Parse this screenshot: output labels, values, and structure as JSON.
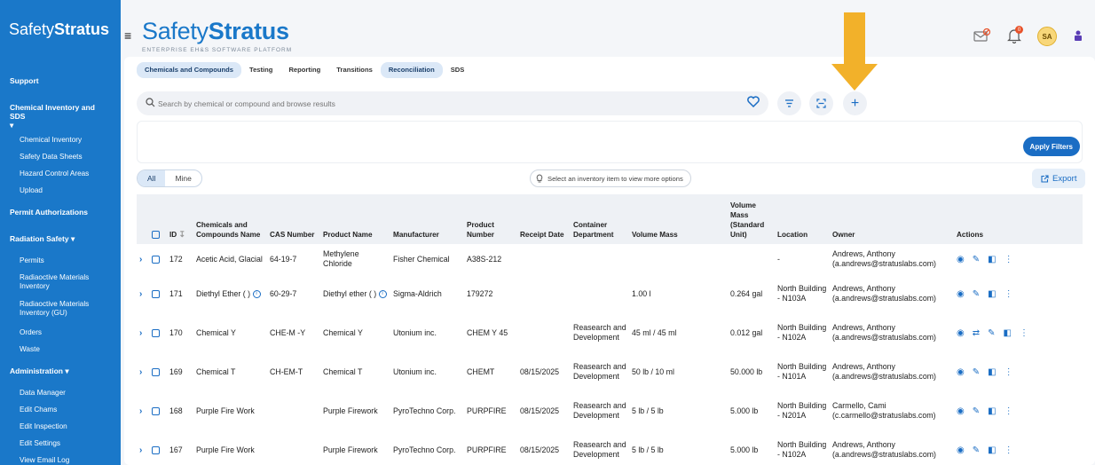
{
  "sidebar": {
    "logo_light": "Safety",
    "logo_bold": "Stratus",
    "sections": [
      {
        "label": "Support",
        "items": []
      },
      {
        "label": "Chemical Inventory and SDS",
        "caret": "▾",
        "items": [
          "Chemical Inventory",
          "Safety Data Sheets",
          "Hazard Control Areas",
          "Upload"
        ]
      },
      {
        "label": "Permit Authorizations",
        "items": []
      },
      {
        "label": "Radiation Safety ▾",
        "items": [
          "Permits",
          "Radiaoctive Materials Inventory",
          "Radiaoctive Materials Inventory (GU)",
          "Orders",
          "Waste"
        ]
      },
      {
        "label": "Administration ▾",
        "items": [
          "Data Manager",
          "Edit Chams",
          "Edit Inspection",
          "Edit Settings",
          "View Email Log"
        ]
      }
    ]
  },
  "header": {
    "brand_light": "Safety",
    "brand_bold": "Stratus",
    "brand_sub": "ENTERPRISE EH&S SOFTWARE PLATFORM",
    "notification_count": "0",
    "avatar": "SA"
  },
  "tabs": [
    "Chemicals and Compounds",
    "Testing",
    "Reporting",
    "Transitions",
    "Reconciliation",
    "SDS"
  ],
  "active_tabs": [
    0,
    4
  ],
  "search": {
    "placeholder": "Search by chemical or compound and browse results"
  },
  "apply_filters": "Apply Filters",
  "segment": {
    "all": "All",
    "mine": "Mine"
  },
  "hint": "Select an inventory item to view more options",
  "export": "Export",
  "table": {
    "headers": {
      "id": "ID",
      "name": "Chemicals and Compounds Name",
      "cas": "CAS Number",
      "product": "Product Name",
      "manufacturer": "Manufacturer",
      "product_number": "Product Number",
      "receipt": "Receipt Date",
      "dept": "Container Department",
      "volume": "Volume Mass",
      "volume_std": "Volume Mass (Standard Unit)",
      "location": "Location",
      "owner": "Owner",
      "actions": "Actions"
    },
    "rows": [
      {
        "id": "172",
        "name": "Acetic Acid, Glacial",
        "cas": "64-19-7",
        "product": "Methylene Chloride",
        "manufacturer": "Fisher Chemical",
        "product_number": "A38S-212",
        "receipt": "",
        "dept": "",
        "volume": "",
        "volume_std": "",
        "location": "-",
        "owner": "Andrews, Anthony (a.andrews@stratuslabs.com)"
      },
      {
        "id": "171",
        "name": "Diethyl Ether ( )",
        "cas": "60-29-7",
        "product": "Diethyl ether ( )",
        "manufacturer": "Sigma-Aldrich",
        "product_number": "179272",
        "receipt": "",
        "dept": "",
        "volume": "1.00 l",
        "volume_std": "0.264 gal",
        "location": "North Building - N103A",
        "owner": "Andrews, Anthony (a.andrews@stratuslabs.com)"
      },
      {
        "id": "170",
        "name": "Chemical Y",
        "cas": "CHE-M -Y",
        "product": "Chemical Y",
        "manufacturer": "Utonium inc.",
        "product_number": "CHEM Y 45",
        "receipt": "",
        "dept": "Reasearch and Development",
        "volume": "45 ml / 45 ml",
        "volume_std": "0.012 gal",
        "location": "North Building - N102A",
        "owner": "Andrews, Anthony (a.andrews@stratuslabs.com)"
      },
      {
        "id": "169",
        "name": "Chemical T",
        "cas": "CH-EM-T",
        "product": "Chemical T",
        "manufacturer": "Utonium inc.",
        "product_number": "CHEMT",
        "receipt": "08/15/2025",
        "dept": "Reasearch and Development",
        "volume": "50 lb / 10 ml",
        "volume_std": "50.000 lb",
        "location": "North Building - N101A",
        "owner": "Andrews, Anthony (a.andrews@stratuslabs.com)"
      },
      {
        "id": "168",
        "name": "Purple Fire Work",
        "cas": "",
        "product": "Purple Firework",
        "manufacturer": "PyroTechno Corp.",
        "product_number": "PURPFIRE",
        "receipt": "08/15/2025",
        "dept": "Reasearch and Development",
        "volume": "5 lb / 5 lb",
        "volume_std": "5.000 lb",
        "location": "North Building - N201A",
        "owner": "Carmello, Cami (c.carmello@stratuslabs.com)"
      },
      {
        "id": "167",
        "name": "Purple Fire Work",
        "cas": "",
        "product": "Purple Firework",
        "manufacturer": "PyroTechno Corp.",
        "product_number": "PURPFIRE",
        "receipt": "08/15/2025",
        "dept": "Reasearch and Development",
        "volume": "5 lb / 5 lb",
        "volume_std": "5.000 lb",
        "location": "North Building - N102A",
        "owner": "Andrews, Anthony (a.andrews@stratuslabs.com)"
      }
    ]
  },
  "colors": {
    "brand": "#1a78c9",
    "accent": "#1a6dc4",
    "arrow": "#f2b12a"
  }
}
